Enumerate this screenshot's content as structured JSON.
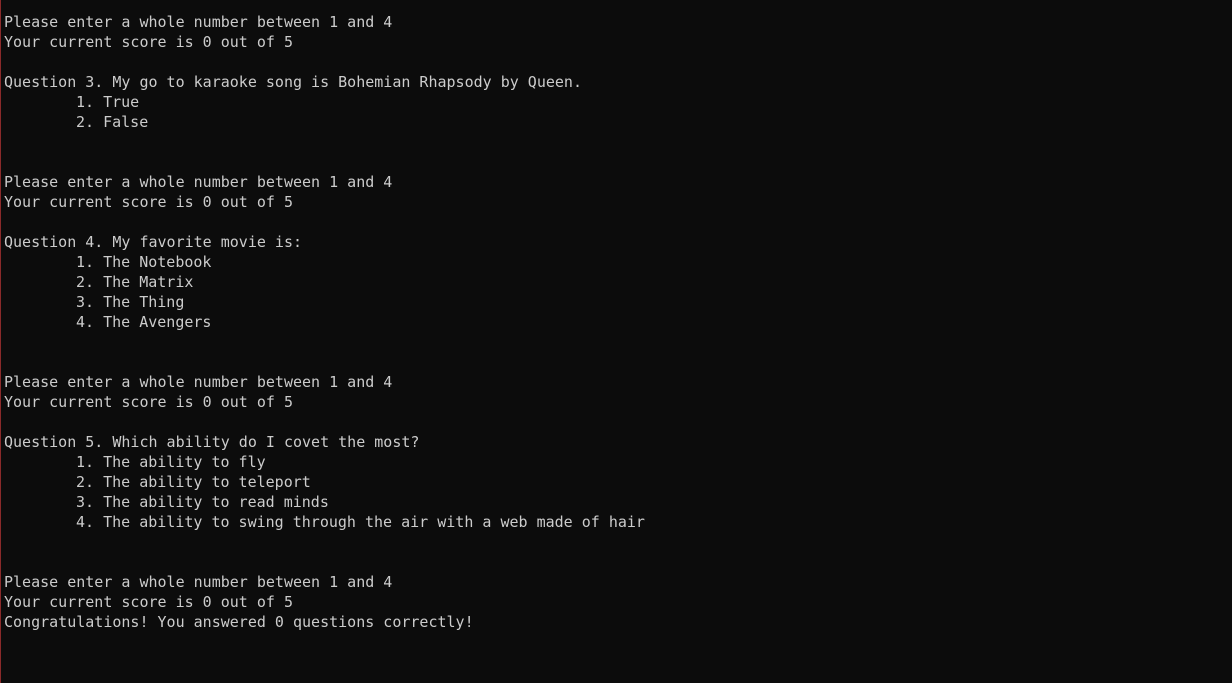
{
  "console": {
    "lines": [
      {
        "text": "Please enter a whole number between 1 and 4"
      },
      {
        "text": "Your current score is 0 out of 5"
      },
      {
        "text": ""
      },
      {
        "text": "Question 3. My go to karaoke song is Bohemian Rhapsody by Queen."
      },
      {
        "text": "1. True",
        "option": true
      },
      {
        "text": "2. False",
        "option": true
      },
      {
        "text": ""
      },
      {
        "text": ""
      },
      {
        "text": "Please enter a whole number between 1 and 4"
      },
      {
        "text": "Your current score is 0 out of 5"
      },
      {
        "text": ""
      },
      {
        "text": "Question 4. My favorite movie is:"
      },
      {
        "text": "1. The Notebook",
        "option": true
      },
      {
        "text": "2. The Matrix",
        "option": true
      },
      {
        "text": "3. The Thing",
        "option": true
      },
      {
        "text": "4. The Avengers",
        "option": true
      },
      {
        "text": ""
      },
      {
        "text": ""
      },
      {
        "text": "Please enter a whole number between 1 and 4"
      },
      {
        "text": "Your current score is 0 out of 5"
      },
      {
        "text": ""
      },
      {
        "text": "Question 5. Which ability do I covet the most?"
      },
      {
        "text": "1. The ability to fly",
        "option": true
      },
      {
        "text": "2. The ability to teleport",
        "option": true
      },
      {
        "text": "3. The ability to read minds",
        "option": true
      },
      {
        "text": "4. The ability to swing through the air with a web made of hair",
        "option": true
      },
      {
        "text": ""
      },
      {
        "text": ""
      },
      {
        "text": "Please enter a whole number between 1 and 4"
      },
      {
        "text": "Your current score is 0 out of 5"
      },
      {
        "text": "Congratulations! You answered 0 questions correctly!"
      }
    ]
  }
}
